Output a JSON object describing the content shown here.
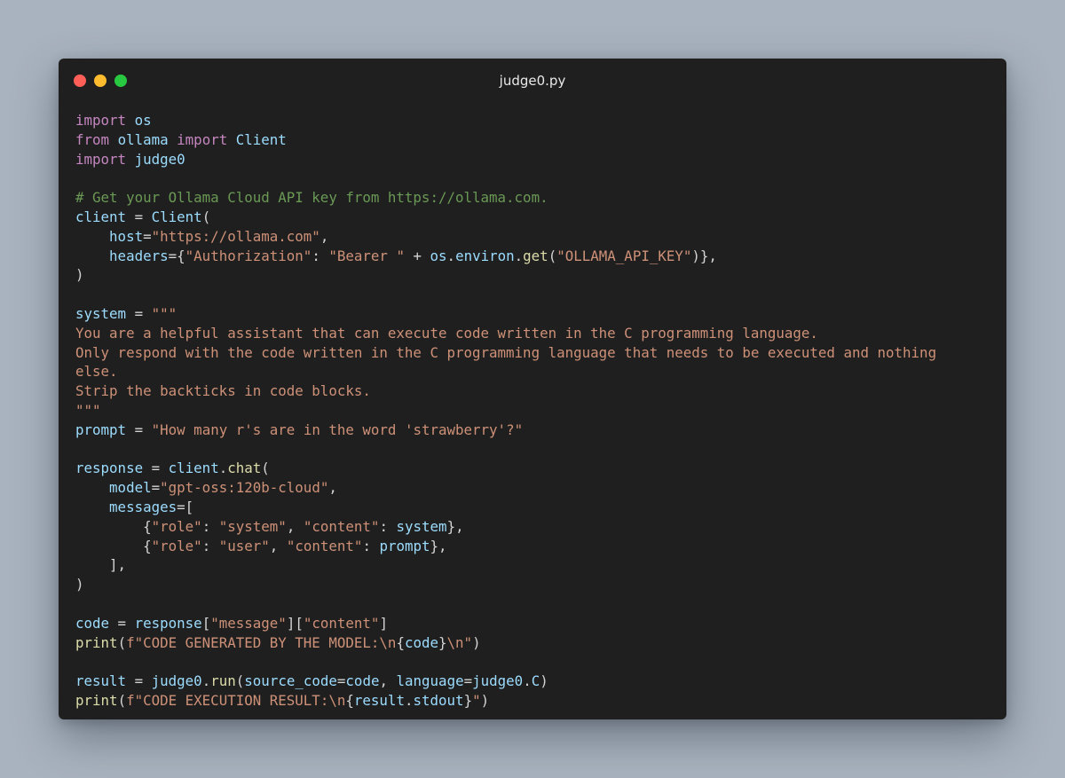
{
  "window": {
    "title": "judge0.py",
    "traffic_lights": {
      "close_color": "#ff5f57",
      "minimize_color": "#febc2e",
      "zoom_color": "#28c840"
    }
  },
  "code_lines": [
    [
      {
        "t": "import",
        "c": "kw"
      },
      {
        "t": " "
      },
      {
        "t": "os",
        "c": "var"
      }
    ],
    [
      {
        "t": "from",
        "c": "kw"
      },
      {
        "t": " "
      },
      {
        "t": "ollama",
        "c": "var"
      },
      {
        "t": " "
      },
      {
        "t": "import",
        "c": "kw"
      },
      {
        "t": " "
      },
      {
        "t": "Client",
        "c": "var"
      }
    ],
    [
      {
        "t": "import",
        "c": "kw"
      },
      {
        "t": " "
      },
      {
        "t": "judge0",
        "c": "var"
      }
    ],
    [],
    [
      {
        "t": "# Get your Ollama Cloud API key from https://ollama.com.",
        "c": "cmt"
      }
    ],
    [
      {
        "t": "client",
        "c": "var"
      },
      {
        "t": " = "
      },
      {
        "t": "Client",
        "c": "var"
      },
      {
        "t": "("
      }
    ],
    [
      {
        "t": "    "
      },
      {
        "t": "host",
        "c": "var"
      },
      {
        "t": "="
      },
      {
        "t": "\"https://ollama.com\"",
        "c": "str"
      },
      {
        "t": ","
      }
    ],
    [
      {
        "t": "    "
      },
      {
        "t": "headers",
        "c": "var"
      },
      {
        "t": "={"
      },
      {
        "t": "\"Authorization\"",
        "c": "str"
      },
      {
        "t": ": "
      },
      {
        "t": "\"Bearer \"",
        "c": "str"
      },
      {
        "t": " + "
      },
      {
        "t": "os",
        "c": "var"
      },
      {
        "t": "."
      },
      {
        "t": "environ",
        "c": "var"
      },
      {
        "t": "."
      },
      {
        "t": "get",
        "c": "fn"
      },
      {
        "t": "("
      },
      {
        "t": "\"OLLAMA_API_KEY\"",
        "c": "str"
      },
      {
        "t": ")},"
      }
    ],
    [
      {
        "t": ")"
      }
    ],
    [],
    [
      {
        "t": "system",
        "c": "var"
      },
      {
        "t": " = "
      },
      {
        "t": "\"\"\"",
        "c": "str"
      }
    ],
    [
      {
        "t": "You are a helpful assistant that can execute code written in the C programming language.",
        "c": "str"
      }
    ],
    [
      {
        "t": "Only respond with the code written in the C programming language that needs to be executed and nothing",
        "c": "str"
      }
    ],
    [
      {
        "t": "else.",
        "c": "str"
      }
    ],
    [
      {
        "t": "Strip the backticks in code blocks.",
        "c": "str"
      }
    ],
    [
      {
        "t": "\"\"\"",
        "c": "str"
      }
    ],
    [
      {
        "t": "prompt",
        "c": "var"
      },
      {
        "t": " = "
      },
      {
        "t": "\"How many r's are in the word 'strawberry'?\"",
        "c": "str"
      }
    ],
    [],
    [
      {
        "t": "response",
        "c": "var"
      },
      {
        "t": " = "
      },
      {
        "t": "client",
        "c": "var"
      },
      {
        "t": "."
      },
      {
        "t": "chat",
        "c": "fn"
      },
      {
        "t": "("
      }
    ],
    [
      {
        "t": "    "
      },
      {
        "t": "model",
        "c": "var"
      },
      {
        "t": "="
      },
      {
        "t": "\"gpt-oss:120b-cloud\"",
        "c": "str"
      },
      {
        "t": ","
      }
    ],
    [
      {
        "t": "    "
      },
      {
        "t": "messages",
        "c": "var"
      },
      {
        "t": "=["
      }
    ],
    [
      {
        "t": "        {"
      },
      {
        "t": "\"role\"",
        "c": "str"
      },
      {
        "t": ": "
      },
      {
        "t": "\"system\"",
        "c": "str"
      },
      {
        "t": ", "
      },
      {
        "t": "\"content\"",
        "c": "str"
      },
      {
        "t": ": "
      },
      {
        "t": "system",
        "c": "var"
      },
      {
        "t": "},"
      }
    ],
    [
      {
        "t": "        {"
      },
      {
        "t": "\"role\"",
        "c": "str"
      },
      {
        "t": ": "
      },
      {
        "t": "\"user\"",
        "c": "str"
      },
      {
        "t": ", "
      },
      {
        "t": "\"content\"",
        "c": "str"
      },
      {
        "t": ": "
      },
      {
        "t": "prompt",
        "c": "var"
      },
      {
        "t": "},"
      }
    ],
    [
      {
        "t": "    ],"
      }
    ],
    [
      {
        "t": ")"
      }
    ],
    [],
    [
      {
        "t": "code",
        "c": "var"
      },
      {
        "t": " = "
      },
      {
        "t": "response",
        "c": "var"
      },
      {
        "t": "["
      },
      {
        "t": "\"message\"",
        "c": "str"
      },
      {
        "t": "]["
      },
      {
        "t": "\"content\"",
        "c": "str"
      },
      {
        "t": "]"
      }
    ],
    [
      {
        "t": "print",
        "c": "fn"
      },
      {
        "t": "("
      },
      {
        "t": "f\"CODE GENERATED BY THE MODEL:",
        "c": "str"
      },
      {
        "t": "\\n",
        "c": "str"
      },
      {
        "t": "{"
      },
      {
        "t": "code",
        "c": "var"
      },
      {
        "t": "}"
      },
      {
        "t": "\\n\"",
        "c": "str"
      },
      {
        "t": ")"
      }
    ],
    [],
    [
      {
        "t": "result",
        "c": "var"
      },
      {
        "t": " = "
      },
      {
        "t": "judge0",
        "c": "var"
      },
      {
        "t": "."
      },
      {
        "t": "run",
        "c": "fn"
      },
      {
        "t": "("
      },
      {
        "t": "source_code",
        "c": "var"
      },
      {
        "t": "="
      },
      {
        "t": "code",
        "c": "var"
      },
      {
        "t": ", "
      },
      {
        "t": "language",
        "c": "var"
      },
      {
        "t": "="
      },
      {
        "t": "judge0",
        "c": "var"
      },
      {
        "t": "."
      },
      {
        "t": "C",
        "c": "var"
      },
      {
        "t": ")"
      }
    ],
    [
      {
        "t": "print",
        "c": "fn"
      },
      {
        "t": "("
      },
      {
        "t": "f\"CODE EXECUTION RESULT:",
        "c": "str"
      },
      {
        "t": "\\n",
        "c": "str"
      },
      {
        "t": "{"
      },
      {
        "t": "result",
        "c": "var"
      },
      {
        "t": "."
      },
      {
        "t": "stdout",
        "c": "var"
      },
      {
        "t": "}"
      },
      {
        "t": "\"",
        "c": "str"
      },
      {
        "t": ")"
      }
    ]
  ]
}
